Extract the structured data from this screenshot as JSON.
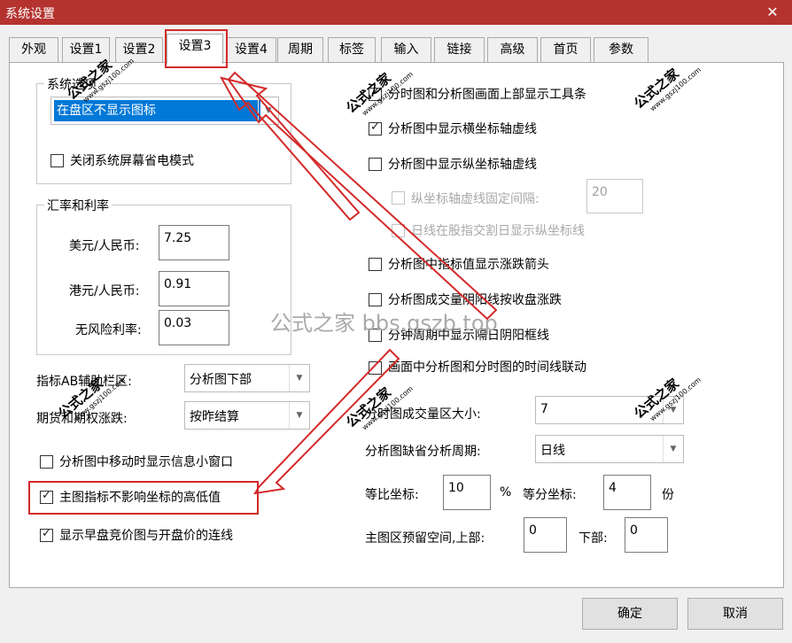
{
  "window": {
    "title": "系统设置",
    "close_glyph": "✕"
  },
  "tabs": [
    "外观",
    "设置1",
    "设置2",
    "设置3",
    "设置4",
    "周期",
    "标签",
    "输入",
    "链接",
    "高级",
    "首页",
    "参数"
  ],
  "system_group": {
    "label": "系统选项",
    "combo_value": "在盘区不显示图标",
    "screensaver_label": "关闭系统屏幕省电模式"
  },
  "rate_group": {
    "label": "汇率和利率",
    "usd_label": "美元/人民币:",
    "usd_value": "7.25",
    "hkd_label": "港元/人民币:",
    "hkd_value": "0.91",
    "riskfree_label": "无风险利率:",
    "riskfree_value": "0.03"
  },
  "left": {
    "ab_label": "指标AB辅助栏区:",
    "ab_value": "分析图下部",
    "futures_label": "期货和期权涨跌:",
    "futures_value": "按昨结算",
    "info_window_label": "分析图中移动时显示信息小窗口",
    "main_index_label": "主图指标不影响坐标的高低值",
    "auction_label": "显示早盘竞价图与开盘价的连线"
  },
  "right": {
    "toolbar_label": "分时图和分析图画面上部显示工具条",
    "hgrid_label": "分析图中显示横坐标轴虚线",
    "vgrid_label": "分析图中显示纵坐标轴虚线",
    "vgrid_fixed_label": "纵坐标轴虚线固定间隔:",
    "vgrid_fixed_value": "20",
    "dayline_label": "日线在股指交割日显示纵坐标线",
    "arrow_label": "分析图中指标值显示涨跌箭头",
    "volume_color_label": "分析图成交量阴阳线按收盘涨跌",
    "cross_day_label": "分钟周期中显示隔日阴阳框线",
    "link_label": "画面中分析图和分时图的时间线联动",
    "volume_size_label": "分时图成交量区大小:",
    "volume_size_value": "7",
    "default_period_label": "分析图缺省分析周期:",
    "default_period_value": "日线",
    "ratio_label": "等比坐标:",
    "ratio_value": "10",
    "percent": "%",
    "equal_label": "等分坐标:",
    "equal_value": "4",
    "portion": "份",
    "reserve_label": "主图区预留空间,上部:",
    "reserve_top": "0",
    "reserve_bottom_label": "下部:",
    "reserve_bottom": "0"
  },
  "buttons": {
    "ok": "确定",
    "cancel": "取消"
  },
  "watermark": {
    "text": "公式之家",
    "url": "www.gszj100.com",
    "center": "公式之家 bbs.gszb.top"
  },
  "colors": {
    "titlebar": "#b4332f",
    "highlight": "#d42a2a",
    "selection": "#0078d7"
  }
}
